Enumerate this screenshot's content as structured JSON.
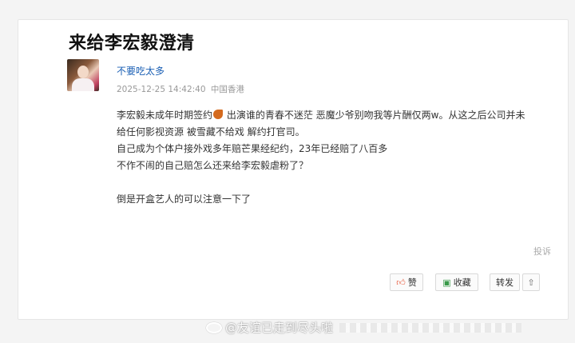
{
  "post": {
    "title": "来给李宏毅澄清",
    "author": "不要吃太多",
    "timestamp": "2025-12-25 14:42:40",
    "location": "中国香港",
    "lines": [
      {
        "before": "李宏毅未成年时期签约",
        "emoji": "orange-emoji",
        "after": " 出演谁的青春不迷茫 恶魔少爷别吻我等片酬仅两w。从这之后公司并未"
      },
      {
        "text": "给任何影视资源 被雪藏不给戏 解约打官司。"
      },
      {
        "text": "自己成为个体户接外戏多年赔芒果经纪约，23年已经赔了八百多"
      },
      {
        "text": "不作不闹的自己赔怎么还来给李宏毅虐粉了？"
      },
      {
        "text": ""
      },
      {
        "text": "倒是开盒艺人的可以注意一下了"
      }
    ]
  },
  "actions": {
    "report": "投诉",
    "like": "赞",
    "favorite": "收藏",
    "repost": "转发"
  },
  "watermark": {
    "text": "@友谊已走到尽头啦"
  },
  "colors": {
    "author_link": "#1a5fb4",
    "like_icon": "#e8583a",
    "favorite_icon": "#3a9a4a"
  }
}
